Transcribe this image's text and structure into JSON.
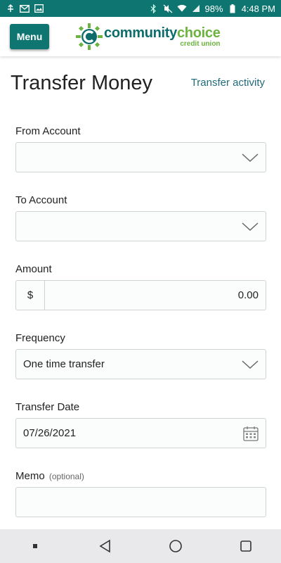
{
  "status_bar": {
    "time": "4:48 PM",
    "battery": "98%",
    "left_icons": [
      "usb-debug-icon",
      "gmail-icon",
      "image-icon"
    ],
    "right_icons": [
      "bluetooth-icon",
      "vibrate-mute-icon",
      "wifi-icon",
      "signal-icon",
      "battery-icon"
    ]
  },
  "header": {
    "menu_label": "Menu",
    "logo_main_1": "community",
    "logo_main_2": "choice",
    "logo_sub": "credit union"
  },
  "page": {
    "title": "Transfer Money",
    "activity_link": "Transfer activity"
  },
  "form": {
    "from_account": {
      "label": "From Account",
      "value": ""
    },
    "to_account": {
      "label": "To Account",
      "value": ""
    },
    "amount": {
      "label": "Amount",
      "prefix": "$",
      "value": "0.00"
    },
    "frequency": {
      "label": "Frequency",
      "value": "One time transfer"
    },
    "transfer_date": {
      "label": "Transfer Date",
      "value": "07/26/2021"
    },
    "memo": {
      "label": "Memo",
      "optional": "(optional)",
      "value": ""
    }
  },
  "nav": {
    "icons": [
      "recents-dot-icon",
      "back-icon",
      "home-icon",
      "overview-icon"
    ]
  },
  "colors": {
    "brand_teal": "#0e7570",
    "brand_green": "#6cb33f",
    "link": "#1f6a79"
  }
}
